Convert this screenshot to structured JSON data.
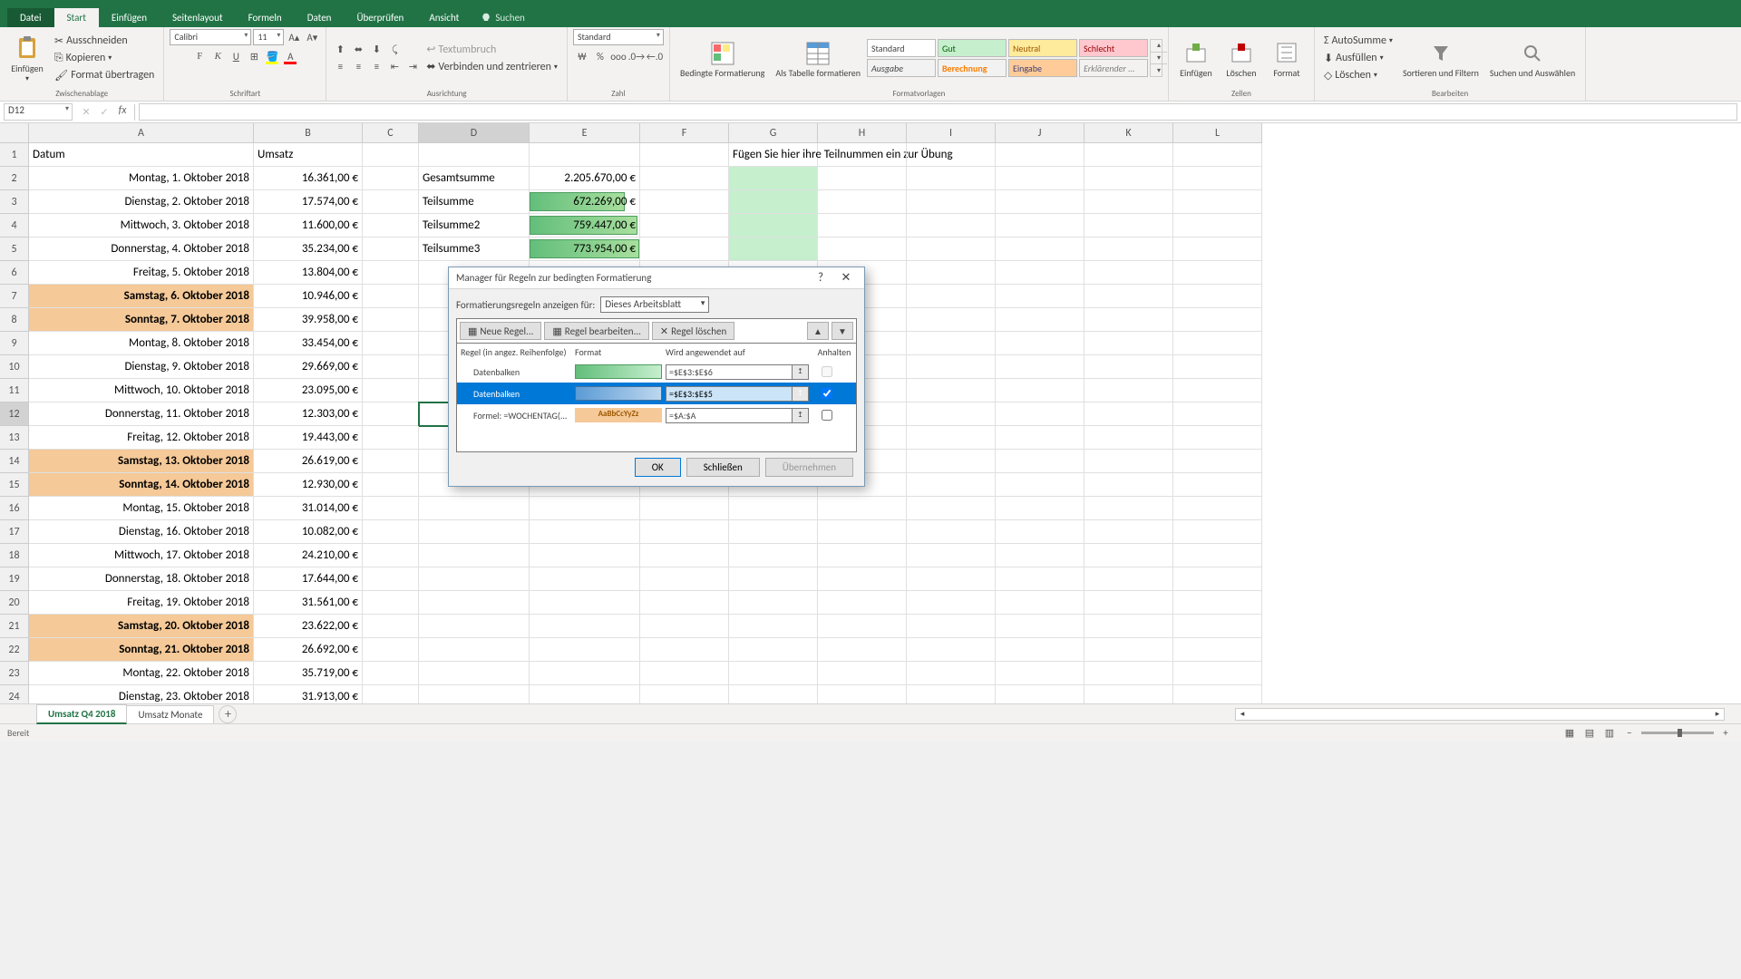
{
  "tabs": {
    "file": "Datei",
    "start": "Start",
    "insert": "Einfügen",
    "pagelayout": "Seitenlayout",
    "formulas": "Formeln",
    "data": "Daten",
    "review": "Überprüfen",
    "view": "Ansicht",
    "tellme": "Suchen"
  },
  "ribbon": {
    "paste": "Einfügen",
    "cut": "Ausschneiden",
    "copy": "Kopieren",
    "formatpainter": "Format übertragen",
    "clipboard": "Zwischenablage",
    "fontname": "Calibri",
    "fontsize": "11",
    "font_label": "Schriftart",
    "wraptext": "Textumbruch",
    "merge": "Verbinden und zentrieren",
    "align_label": "Ausrichtung",
    "numfmt": "Standard",
    "num_label": "Zahl",
    "condfmt": "Bedingte Formatierung",
    "astable": "Als Tabelle formatieren",
    "s_standard": "Standard",
    "s_gut": "Gut",
    "s_neutral": "Neutral",
    "s_schlecht": "Schlecht",
    "s_ausgabe": "Ausgabe",
    "s_berechnung": "Berechnung",
    "s_eingabe": "Eingabe",
    "s_erklar": "Erklärender ...",
    "styles_label": "Formatvorlagen",
    "cellinsert": "Einfügen",
    "celldelete": "Löschen",
    "cellformat": "Format",
    "cells_label": "Zellen",
    "autosum": "AutoSumme",
    "fill": "Ausfüllen",
    "clear": "Löschen",
    "sortfilter": "Sortieren und Filtern",
    "findselect": "Suchen und Auswählen",
    "edit_label": "Bearbeiten"
  },
  "namebox": "D12",
  "colwidths": {
    "A": 248,
    "B": 120,
    "C": 62,
    "D": 122,
    "E": 122,
    "F": 98,
    "G": 98,
    "H": 98,
    "I": 98,
    "J": 98,
    "K": 98,
    "L": 98
  },
  "headers": {
    "A1": "Datum",
    "B1": "Umsatz",
    "G1": "Fügen Sie hier ihre Teilnummen ein zur Übung"
  },
  "rows": [
    {
      "r": 2,
      "date": "Montag, 1. Oktober 2018",
      "val": "16.361,00 €",
      "we": false,
      "D": "Gesamtsumme",
      "E": "2.205.670,00 €"
    },
    {
      "r": 3,
      "date": "Dienstag, 2. Oktober 2018",
      "val": "17.574,00 €",
      "we": false,
      "D": "Teilsumme",
      "E": "672.269,00 €",
      "bar": 87
    },
    {
      "r": 4,
      "date": "Mittwoch, 3. Oktober 2018",
      "val": "11.600,00 €",
      "we": false,
      "D": "Teilsumme2",
      "E": "759.447,00 €",
      "bar": 98
    },
    {
      "r": 5,
      "date": "Donnerstag, 4. Oktober 2018",
      "val": "35.234,00 €",
      "we": false,
      "D": "Teilsumme3",
      "E": "773.954,00 €",
      "bar": 100
    },
    {
      "r": 6,
      "date": "Freitag, 5. Oktober 2018",
      "val": "13.804,00 €",
      "we": false
    },
    {
      "r": 7,
      "date": "Samstag, 6. Oktober 2018",
      "val": "10.946,00 €",
      "we": true
    },
    {
      "r": 8,
      "date": "Sonntag, 7. Oktober 2018",
      "val": "39.958,00 €",
      "we": true
    },
    {
      "r": 9,
      "date": "Montag, 8. Oktober 2018",
      "val": "33.454,00 €",
      "we": false
    },
    {
      "r": 10,
      "date": "Dienstag, 9. Oktober 2018",
      "val": "29.669,00 €",
      "we": false
    },
    {
      "r": 11,
      "date": "Mittwoch, 10. Oktober 2018",
      "val": "23.095,00 €",
      "we": false
    },
    {
      "r": 12,
      "date": "Donnerstag, 11. Oktober 2018",
      "val": "12.303,00 €",
      "we": false,
      "sel": true
    },
    {
      "r": 13,
      "date": "Freitag, 12. Oktober 2018",
      "val": "19.443,00 €",
      "we": false
    },
    {
      "r": 14,
      "date": "Samstag, 13. Oktober 2018",
      "val": "26.619,00 €",
      "we": true
    },
    {
      "r": 15,
      "date": "Sonntag, 14. Oktober 2018",
      "val": "12.930,00 €",
      "we": true
    },
    {
      "r": 16,
      "date": "Montag, 15. Oktober 2018",
      "val": "31.014,00 €",
      "we": false
    },
    {
      "r": 17,
      "date": "Dienstag, 16. Oktober 2018",
      "val": "10.082,00 €",
      "we": false
    },
    {
      "r": 18,
      "date": "Mittwoch, 17. Oktober 2018",
      "val": "24.210,00 €",
      "we": false
    },
    {
      "r": 19,
      "date": "Donnerstag, 18. Oktober 2018",
      "val": "17.644,00 €",
      "we": false
    },
    {
      "r": 20,
      "date": "Freitag, 19. Oktober 2018",
      "val": "31.561,00 €",
      "we": false
    },
    {
      "r": 21,
      "date": "Samstag, 20. Oktober 2018",
      "val": "23.622,00 €",
      "we": true
    },
    {
      "r": 22,
      "date": "Sonntag, 21. Oktober 2018",
      "val": "26.692,00 €",
      "we": true
    },
    {
      "r": 23,
      "date": "Montag, 22. Oktober 2018",
      "val": "35.719,00 €",
      "we": false
    },
    {
      "r": 24,
      "date": "Dienstag, 23. Oktober 2018",
      "val": "31.913,00 €",
      "we": false
    }
  ],
  "sheets": {
    "s1": "Umsatz Q4 2018",
    "s2": "Umsatz Monate"
  },
  "status": "Bereit",
  "dialog": {
    "title": "Manager für Regeln zur bedingten Formatierung",
    "showfor_label": "Formatierungsregeln anzeigen für:",
    "showfor_value": "Dieses Arbeitsblatt",
    "btn_new": "Neue Regel...",
    "btn_edit": "Regel bearbeiten...",
    "btn_del": "Regel löschen",
    "h_rule": "Regel (in angez. Reihenfolge)",
    "h_format": "Format",
    "h_applies": "Wird angewendet auf",
    "h_stop": "Anhalten",
    "rules": [
      {
        "name": "Datenbalken",
        "fmt": "green",
        "range": "=$E$3:$E$6",
        "stop": false,
        "sel": false,
        "stopdisabled": true
      },
      {
        "name": "Datenbalken",
        "fmt": "blue",
        "range": "=$E$3:$E$5",
        "stop": true,
        "sel": true,
        "stopdisabled": false
      },
      {
        "name": "Formel: =WOCHENTAG(...",
        "fmt": "text",
        "preview": "AaBbCcYyZz",
        "range": "=$A:$A",
        "stop": false,
        "sel": false,
        "stopdisabled": false
      }
    ],
    "ok": "OK",
    "close": "Schließen",
    "apply": "Übernehmen"
  }
}
